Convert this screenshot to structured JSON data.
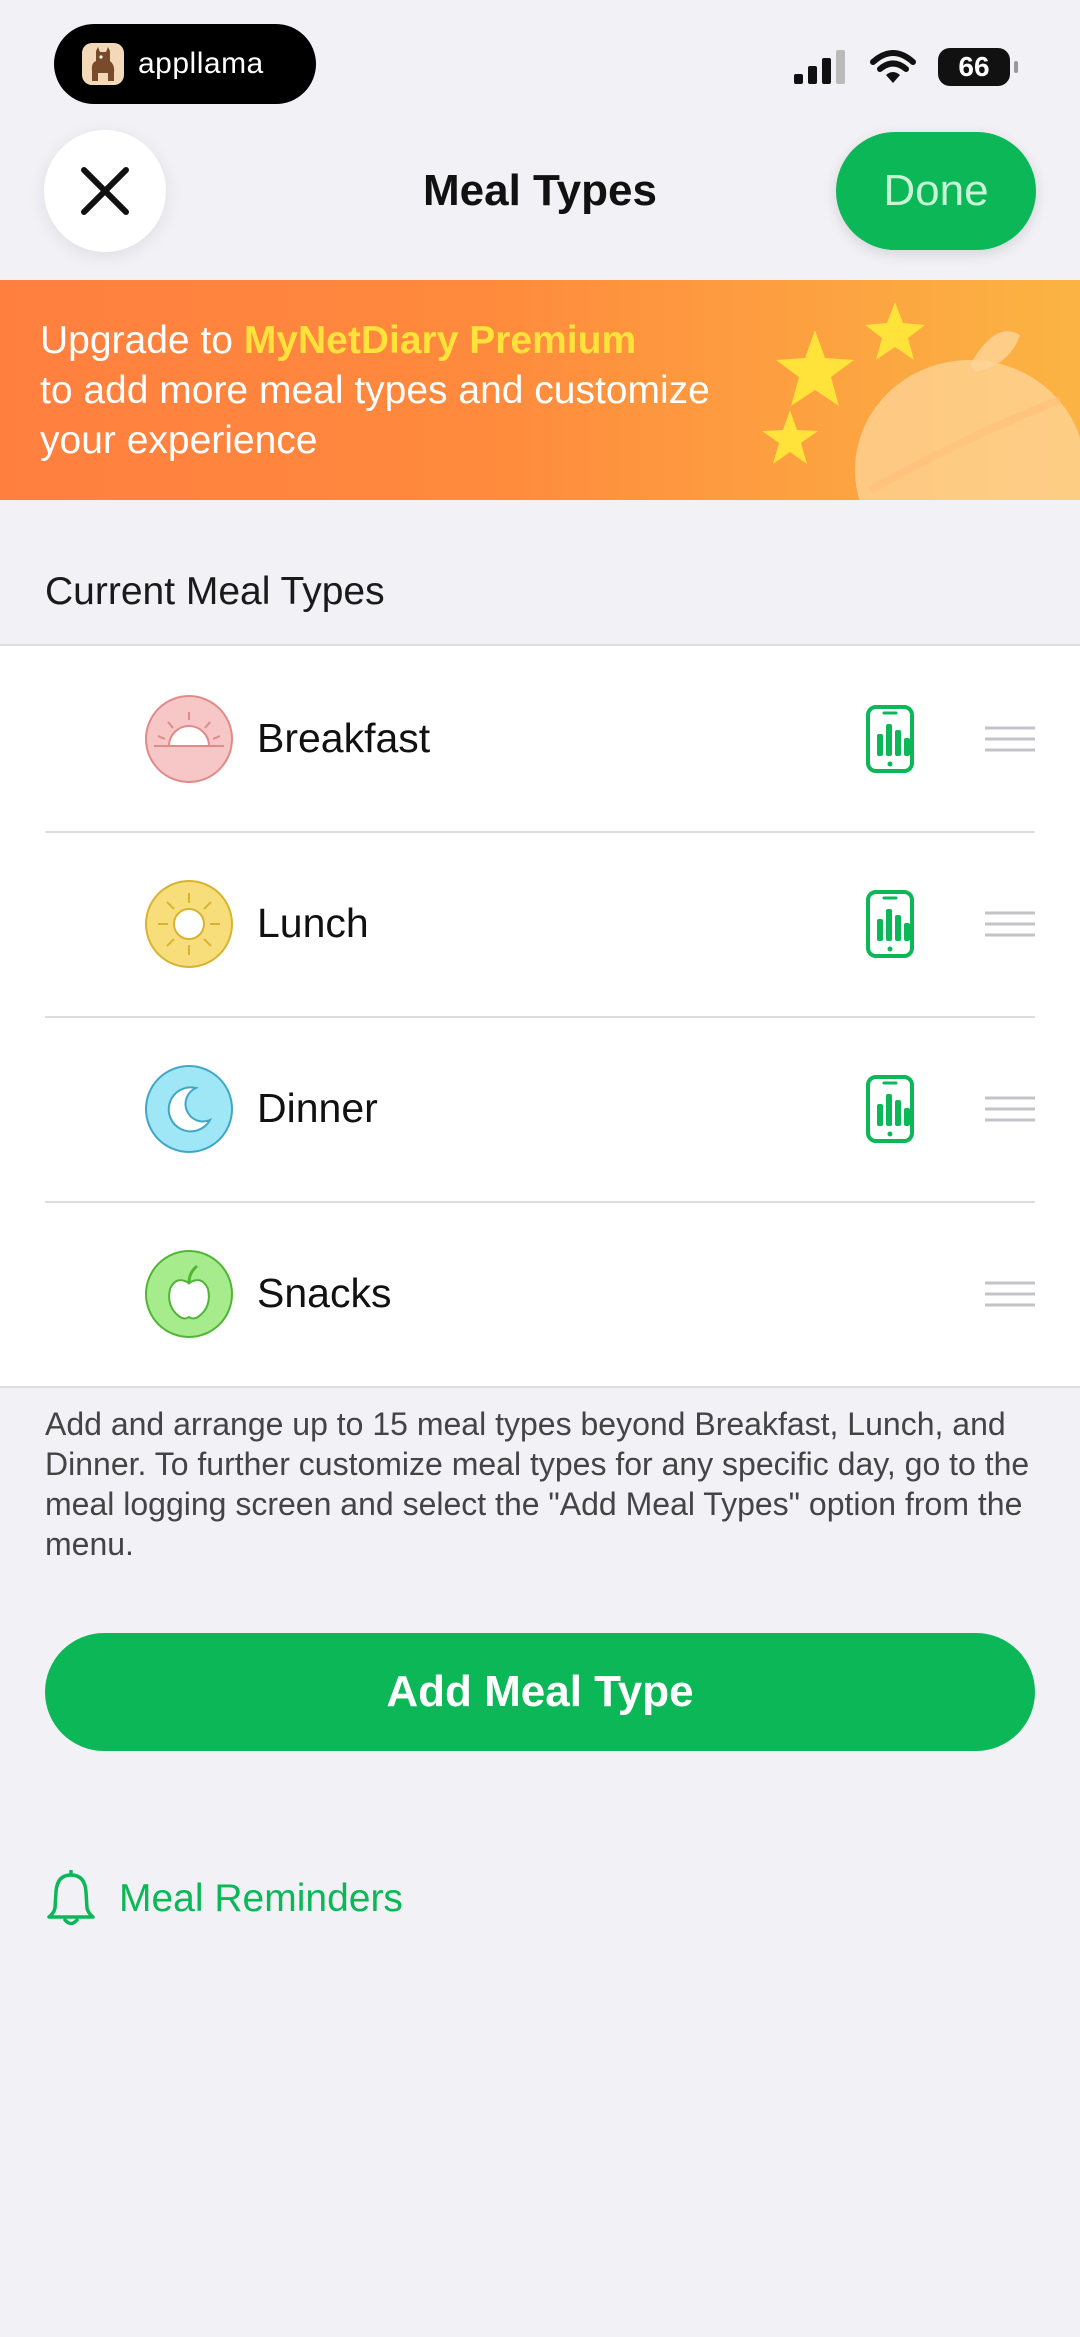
{
  "status_bar": {
    "app_badge": "appllama",
    "battery": "66"
  },
  "header": {
    "title": "Meal Types",
    "done_label": "Done"
  },
  "banner": {
    "prefix": "Upgrade to ",
    "highlight": "MyNetDiary Premium",
    "line2": "to add more meal types and customize",
    "line3": "your experience"
  },
  "section": {
    "title": "Current Meal Types"
  },
  "meals": [
    {
      "label": "Breakfast",
      "icon": "sunrise-icon",
      "color": "#f7c6c6",
      "has_widget": true
    },
    {
      "label": "Lunch",
      "icon": "sun-icon",
      "color": "#f8de7a",
      "has_widget": true
    },
    {
      "label": "Dinner",
      "icon": "moon-icon",
      "color": "#9fe6f7",
      "has_widget": true
    },
    {
      "label": "Snacks",
      "icon": "apple-icon",
      "color": "#a7ec8c",
      "has_widget": false
    }
  ],
  "note": "Add and arrange up to 15 meal types beyond Breakfast, Lunch, and Dinner. To further customize meal types for any specific day, go to the meal logging screen and select the \"Add Meal Types\" option from the menu.",
  "actions": {
    "add_label": "Add Meal Type",
    "reminders_label": "Meal Reminders"
  },
  "colors": {
    "accent": "#0bb757",
    "banner_start": "#ff7f3f",
    "banner_end": "#fbb443",
    "highlight": "#ffe23a"
  }
}
